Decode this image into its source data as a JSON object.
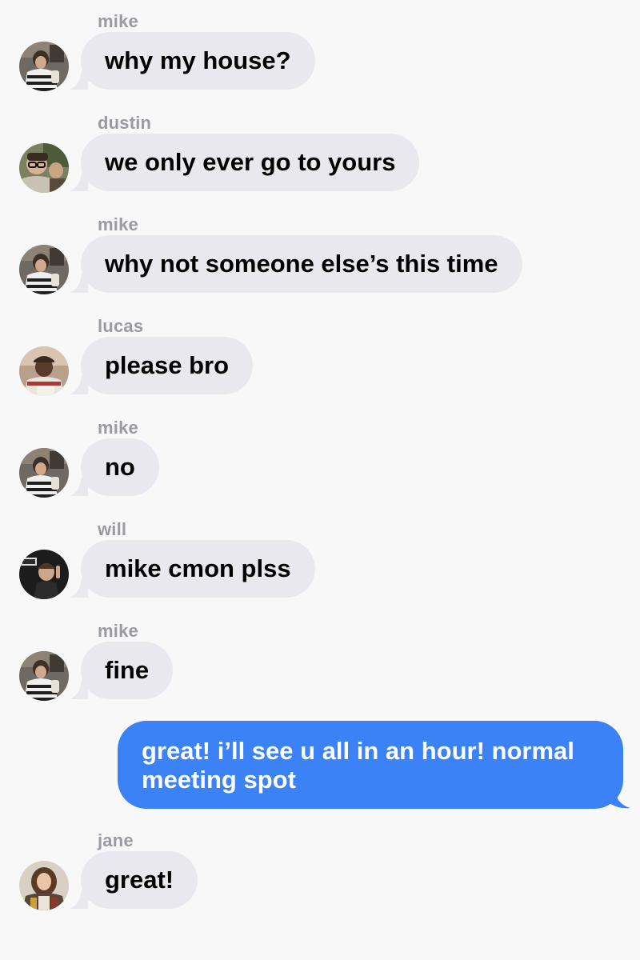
{
  "conversation": {
    "messages": [
      {
        "sender": "mike",
        "text": "why my house?",
        "avatar": "mike-avatar"
      },
      {
        "sender": "dustin",
        "text": "we only ever go to yours",
        "avatar": "dustin-avatar"
      },
      {
        "sender": "mike",
        "text": "why not someone else’s this time",
        "avatar": "mike-avatar"
      },
      {
        "sender": "lucas",
        "text": "please bro",
        "avatar": "lucas-avatar"
      },
      {
        "sender": "mike",
        "text": "no",
        "avatar": "mike-avatar"
      },
      {
        "sender": "will",
        "text": "mike cmon plss",
        "avatar": "will-avatar"
      },
      {
        "sender": "mike",
        "text": "fine",
        "avatar": "mike-avatar"
      }
    ],
    "sent": {
      "line1": "great! i’ll see u all in an hour! normal",
      "line2": "meeting spot"
    },
    "last": {
      "sender": "jane",
      "text": "great!",
      "avatar": "jane-avatar"
    }
  },
  "colors": {
    "background": "#f8f8f9",
    "received_bubble": "#e9e8ee",
    "sent_bubble": "#3a82f6",
    "sender_name": "#9a9aa0"
  }
}
